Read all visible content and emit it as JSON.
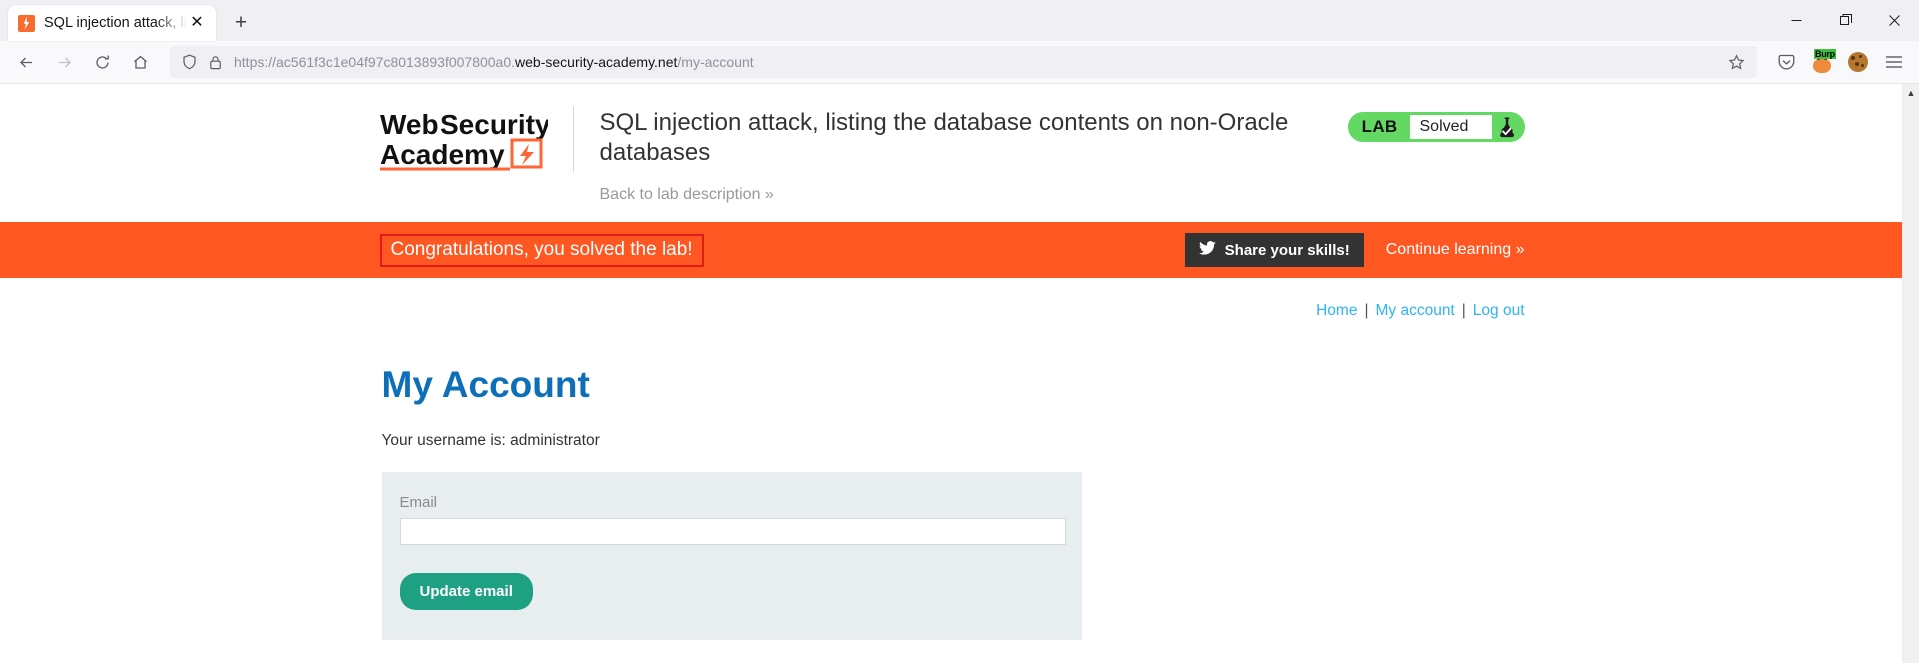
{
  "browser": {
    "tab": {
      "title": "SQL injection attack, listing the d",
      "favicon": "portswigger-favicon-icon",
      "close_label": "✕"
    },
    "new_tab_label": "+",
    "window_controls": {
      "minimize": "—",
      "maximize": "❐",
      "close": "✕"
    },
    "nav": {
      "back": "←",
      "forward": "→",
      "reload": "⟳",
      "home": "⌂"
    },
    "url": {
      "scheme_and_sub": "https://ac561f3c1e04f97c8013893f007800a0.",
      "host": "web-security-academy.net",
      "path": "/my-account",
      "full": "https://ac561f3c1e04f97c8013893f007800a0.web-security-academy.net/my-account",
      "shield_icon": "shield-icon",
      "lock_icon": "padlock-icon",
      "bookmark_icon": "star-icon"
    },
    "toolbar_right": {
      "pocket": "pocket-icon",
      "burp_label": "Burp",
      "burp": "burp-suite-extension-icon",
      "cookie": "cookie-editor-icon",
      "menu": "hamburger-menu-icon"
    },
    "scrollbar": {
      "up": "▲",
      "down": "▼"
    }
  },
  "lab": {
    "logo_line1": "Web Security",
    "logo_line2": "Academy",
    "title": "SQL injection attack, listing the database contents on non-Oracle databases",
    "back_link": "Back to lab description »",
    "status": {
      "tag": "LAB",
      "state": "Solved",
      "flask_icon": "flask-solved-icon",
      "pill_color": "#63d963"
    }
  },
  "banner": {
    "message": "Congratulations, you solved the lab!",
    "highlight_color": "#e01b1b",
    "background_color": "#ff5722",
    "share_label": "Share your skills!",
    "share_icon": "twitter-bird-icon",
    "continue_label": "Continue learning »"
  },
  "site_nav": {
    "home": "Home",
    "my_account": "My account",
    "log_out": "Log out",
    "separator": "|"
  },
  "account": {
    "heading": "My Account",
    "username_line": "Your username is: administrator",
    "form": {
      "email_label": "Email",
      "email_value": "",
      "email_placeholder": "",
      "submit_label": "Update email"
    }
  }
}
